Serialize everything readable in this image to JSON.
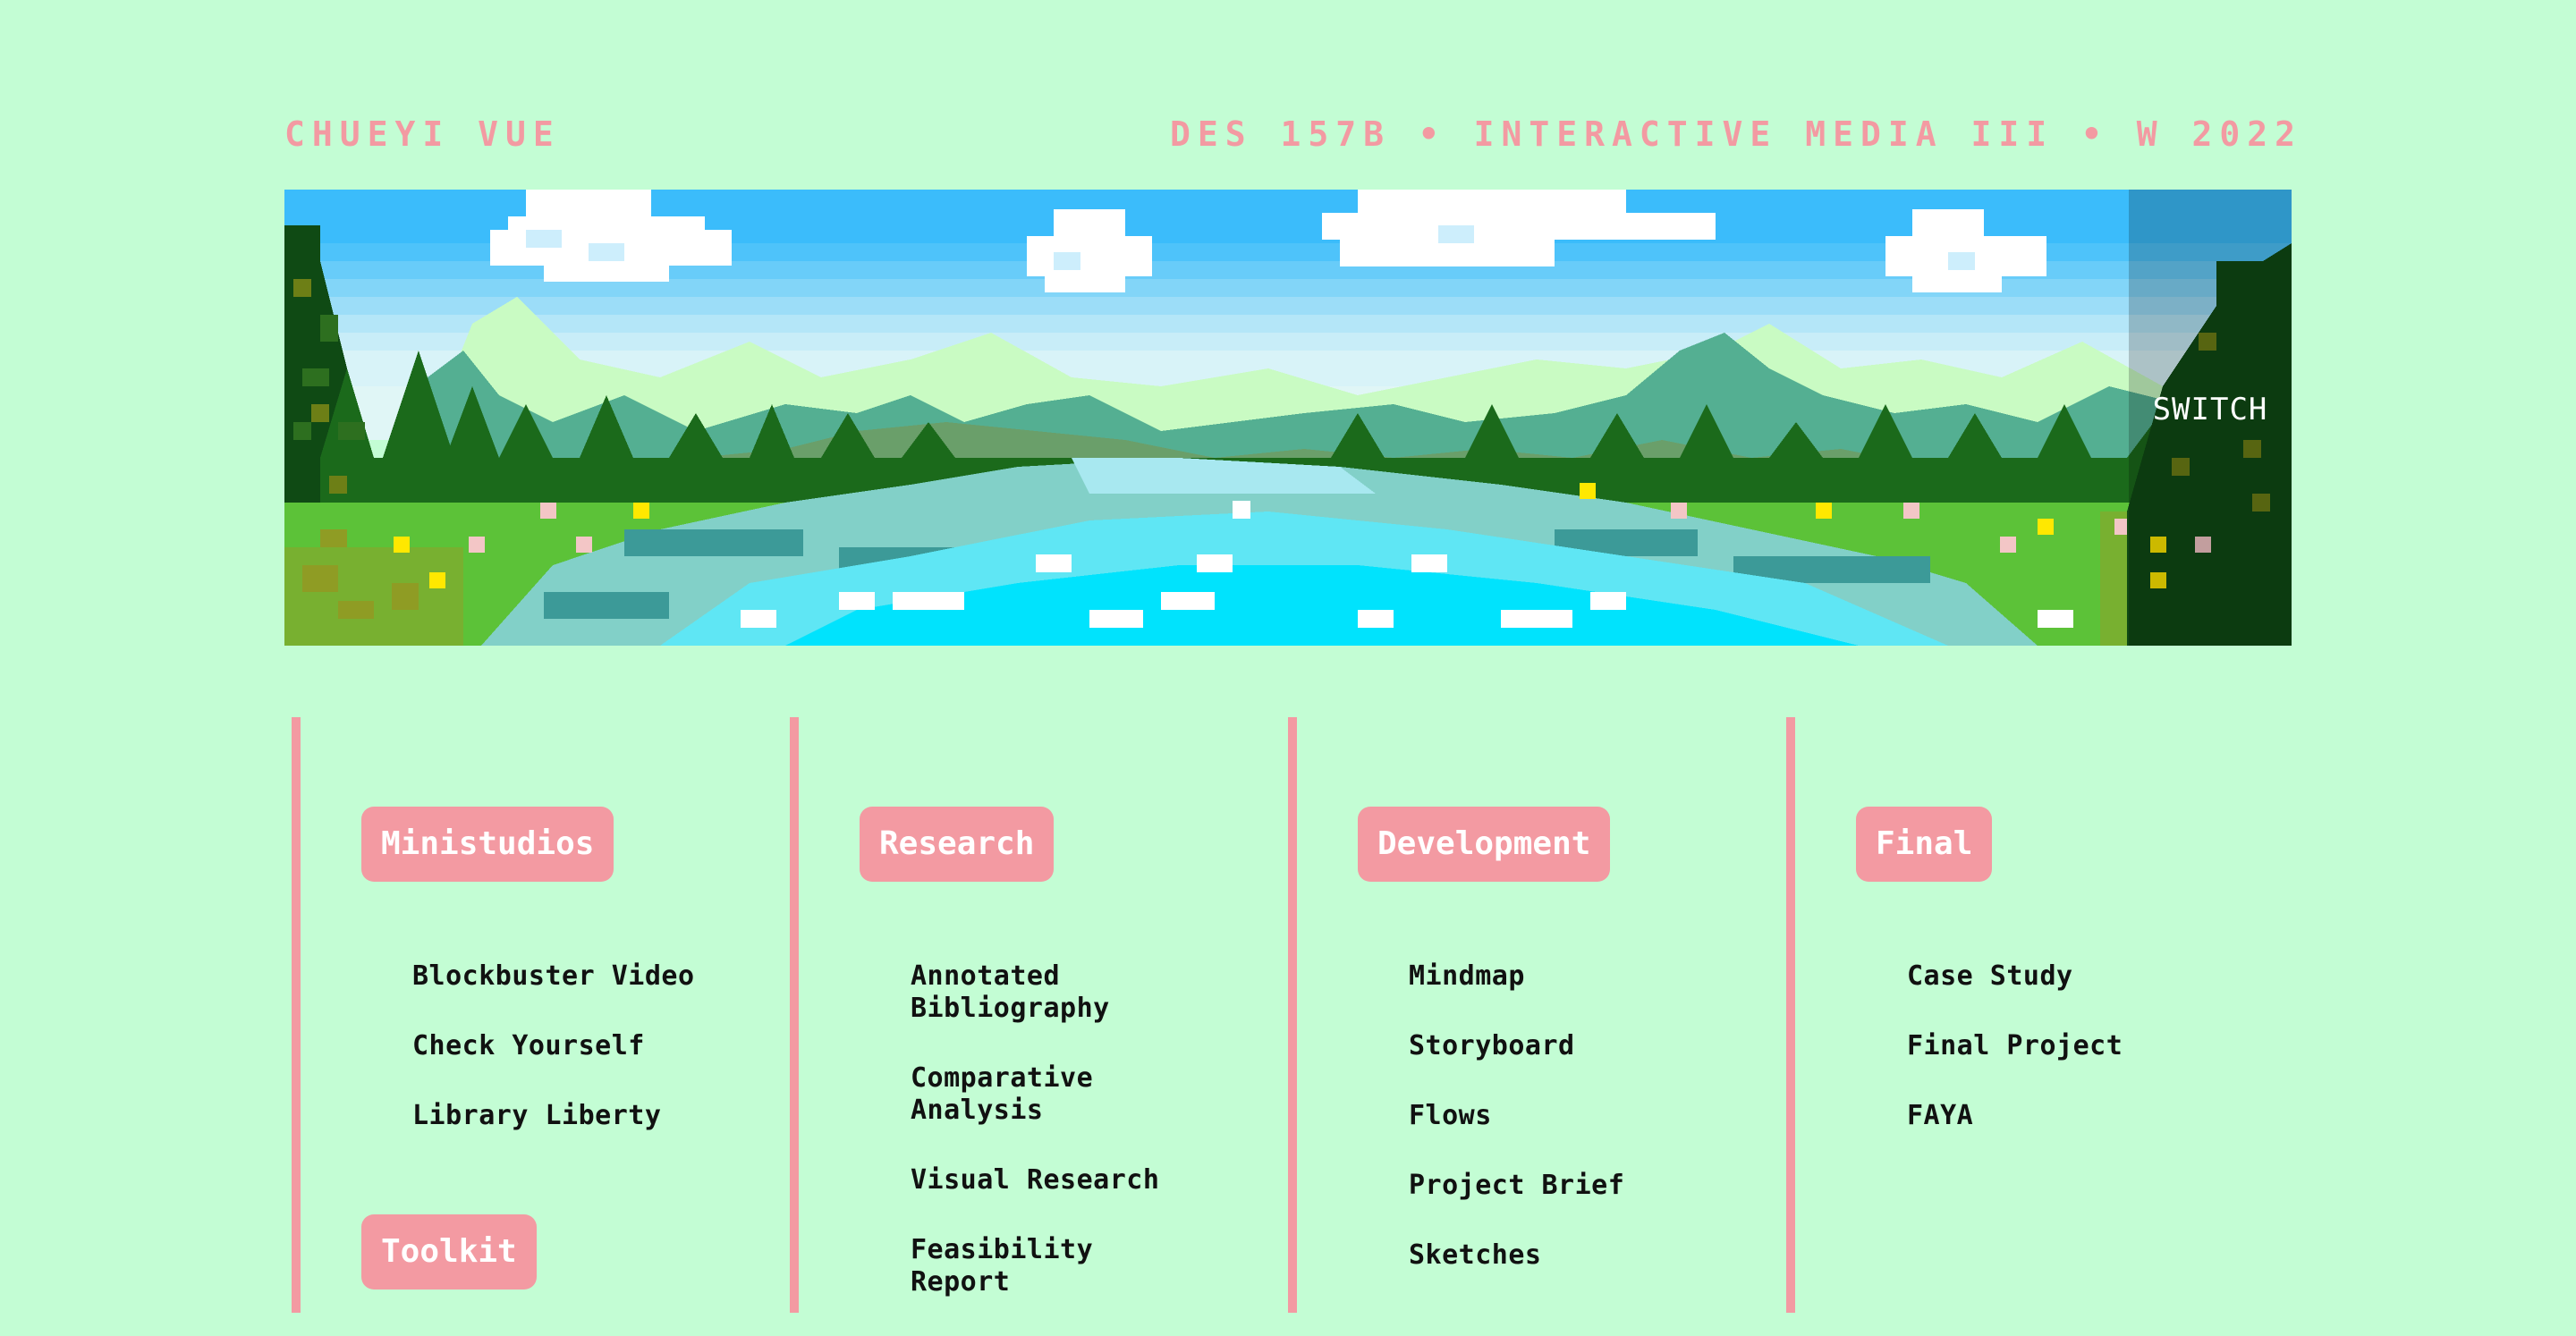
{
  "header": {
    "name": "CHUEYI VUE",
    "course": "DES 157B • INTERACTIVE MEDIA III • W 2022"
  },
  "banner": {
    "scene": "pixel-art lake landscape with mountains, pine trees, clouds and flowers",
    "switch_label": "SWITCH"
  },
  "columns": [
    {
      "title": "Ministudios",
      "links": [
        "Blockbuster Video",
        "Check Yourself",
        "Library Liberty"
      ],
      "extra_title": "Toolkit"
    },
    {
      "title": "Research",
      "links": [
        "Annotated Bibliography",
        "Comparative Analysis",
        "Visual Research",
        "Feasibility Report"
      ]
    },
    {
      "title": "Development",
      "links": [
        "Mindmap",
        "Storyboard",
        "Flows",
        "Project Brief",
        "Sketches"
      ]
    },
    {
      "title": "Final",
      "links": [
        "Case Study",
        "Final Project",
        "FAYA"
      ]
    }
  ],
  "colors": {
    "background": "#c3fdd4",
    "accent_pink": "#f39aa2",
    "link_text": "#111111"
  }
}
